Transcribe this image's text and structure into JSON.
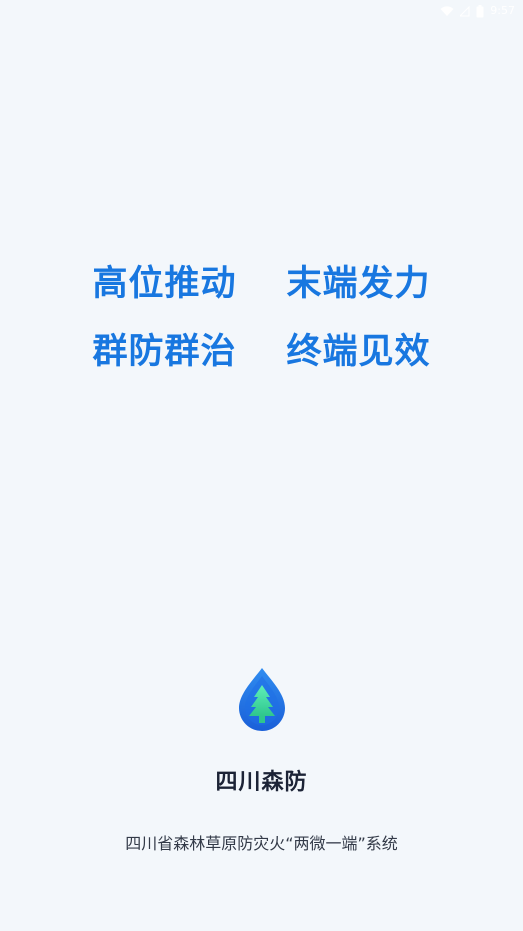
{
  "status_bar": {
    "time": "9:57",
    "icons": [
      "wifi-icon",
      "signal-icon",
      "battery-icon"
    ]
  },
  "slogans": {
    "row1": [
      "高位推动",
      "末端发力"
    ],
    "row2": [
      "群防群治",
      "终端见效"
    ]
  },
  "app": {
    "name": "四川森防",
    "description": "四川省森林草原防灾火“两微一端”系统",
    "logo": "water-drop-tree-logo"
  },
  "colors": {
    "background": "#f3f7fb",
    "slogan": "#1877e0",
    "title": "#1c2336",
    "logo_outer": "#1f6fe6",
    "logo_tree": "#3fd6a0"
  }
}
